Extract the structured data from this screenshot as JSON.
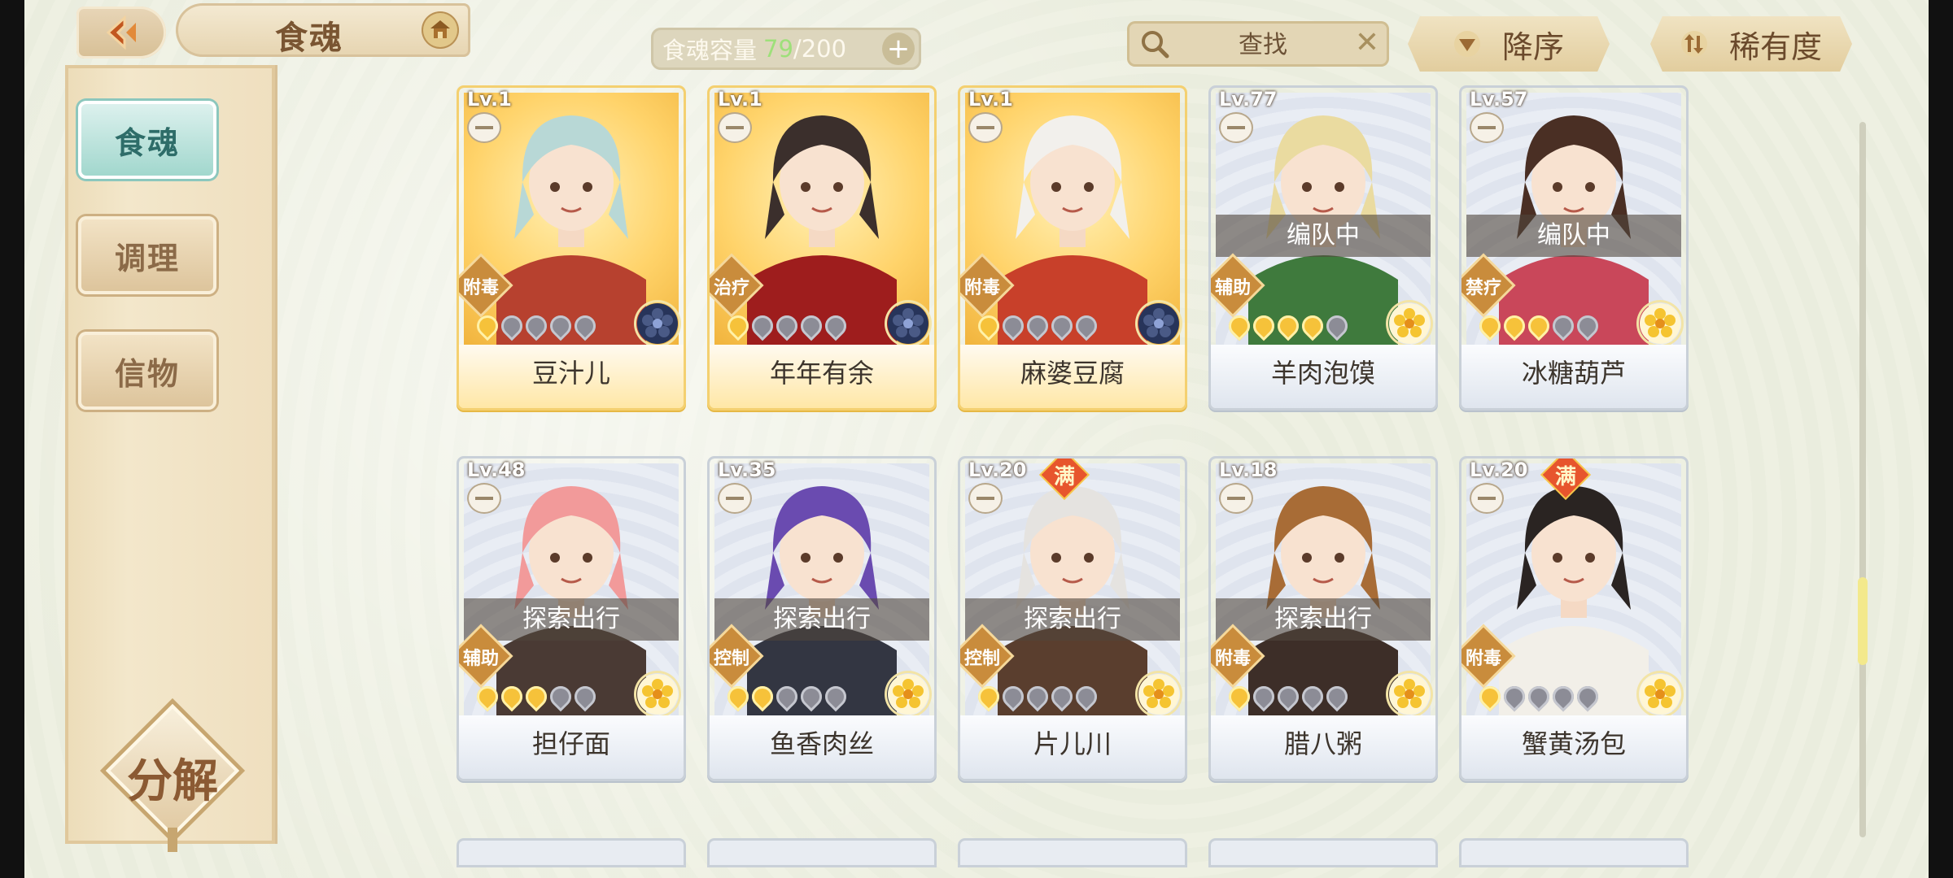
{
  "header": {
    "title": "食魂",
    "capacity_label": "食魂容量",
    "capacity_current": "79",
    "capacity_separator": "/",
    "capacity_max": "200",
    "capacity_add": "+",
    "search_placeholder": "查找",
    "search_clear": "✕",
    "sort_order_label": "降序",
    "sort_by_label": "稀有度"
  },
  "sidebar": {
    "tabs": [
      {
        "label": "食魂",
        "active": true
      },
      {
        "label": "调理",
        "active": false
      },
      {
        "label": "信物",
        "active": false
      }
    ],
    "decompose_label": "分解"
  },
  "cards": [
    {
      "level": "Lv.1",
      "name": "豆汁儿",
      "role": "附毒",
      "stars": 1,
      "rarity": "gold",
      "element": "dark-flower",
      "status": "",
      "max": false
    },
    {
      "level": "Lv.1",
      "name": "年年有余",
      "role": "治疗",
      "stars": 1,
      "rarity": "gold",
      "element": "dark-flower",
      "status": "",
      "max": false
    },
    {
      "level": "Lv.1",
      "name": "麻婆豆腐",
      "role": "附毒",
      "stars": 1,
      "rarity": "gold",
      "element": "dark-flower",
      "status": "",
      "max": false
    },
    {
      "level": "Lv.77",
      "name": "羊肉泡馍",
      "role": "辅助",
      "stars": 4,
      "rarity": "silver",
      "element": "gold-flower",
      "status": "编队中",
      "max": false
    },
    {
      "level": "Lv.57",
      "name": "冰糖葫芦",
      "role": "禁疗",
      "stars": 3,
      "rarity": "silver",
      "element": "gold-flower",
      "status": "编队中",
      "max": false
    },
    {
      "level": "Lv.48",
      "name": "担仔面",
      "role": "辅助",
      "stars": 3,
      "rarity": "silver",
      "element": "gold-flower",
      "status": "探索出行",
      "max": false
    },
    {
      "level": "Lv.35",
      "name": "鱼香肉丝",
      "role": "控制",
      "stars": 2,
      "rarity": "silver",
      "element": "gold-flower",
      "status": "探索出行",
      "max": false
    },
    {
      "level": "Lv.20",
      "name": "片儿川",
      "role": "控制",
      "stars": 1,
      "rarity": "silver",
      "element": "gold-flower",
      "status": "探索出行",
      "max": true,
      "max_label": "满"
    },
    {
      "level": "Lv.18",
      "name": "腊八粥",
      "role": "附毒",
      "stars": 1,
      "rarity": "silver",
      "element": "gold-flower",
      "status": "探索出行",
      "max": false
    },
    {
      "level": "Lv.20",
      "name": "蟹黄汤包",
      "role": "附毒",
      "stars": 1,
      "rarity": "silver",
      "element": "gold-flower",
      "status": "",
      "max": true,
      "max_label": "满"
    }
  ],
  "colors": {
    "accent_teal": "#9fd6cc",
    "gold_card": "#ffd36a",
    "star_on": "#f6c23a",
    "capacity_current": "#9ee07a"
  },
  "scroll_position": 0.65
}
